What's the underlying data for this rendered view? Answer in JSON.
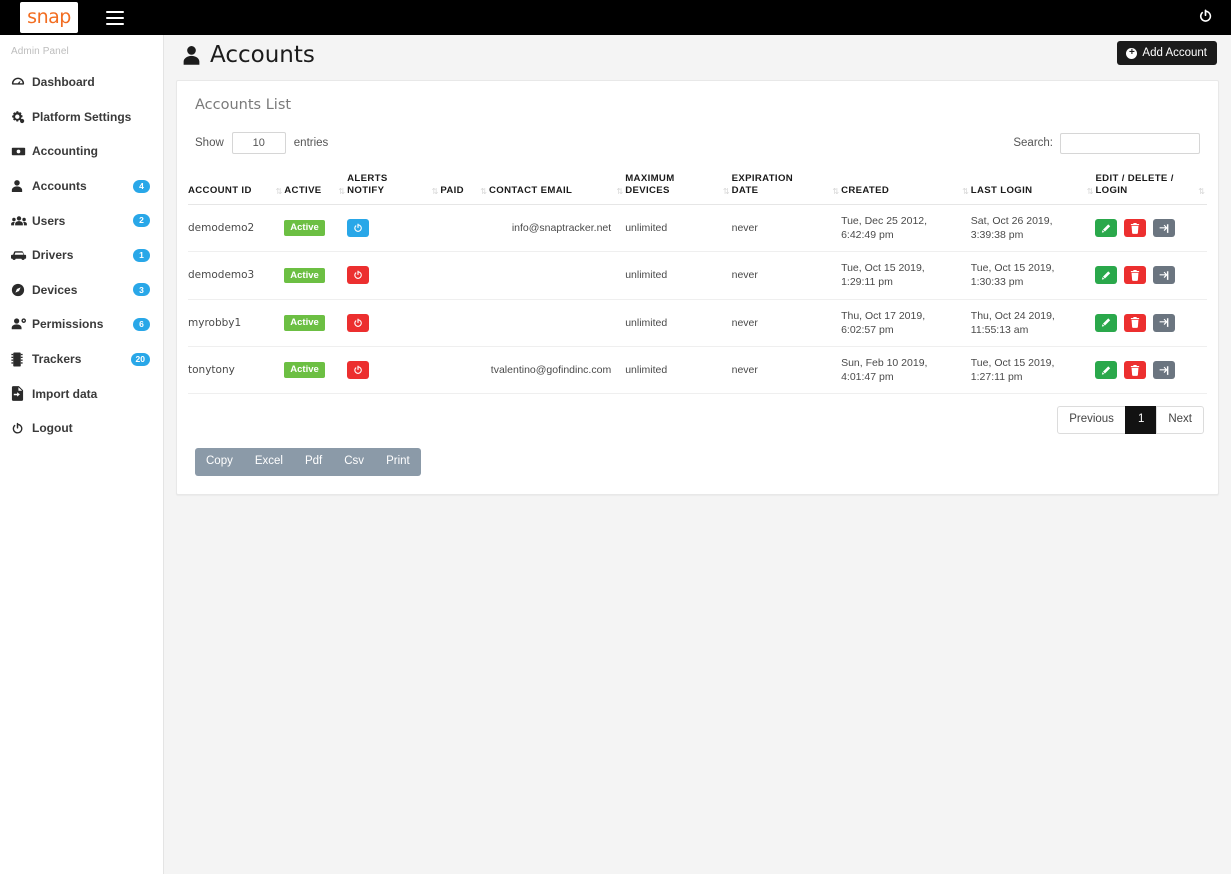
{
  "topbar": {
    "logo_text": "snap",
    "menu_icon": "hamburger-icon",
    "power_icon": "⏻"
  },
  "sidebar": {
    "title": "Admin Panel",
    "items": [
      {
        "label": "Dashboard",
        "icon": "dashboard-icon",
        "badge": ""
      },
      {
        "label": "Platform Settings",
        "icon": "gears-icon",
        "badge": ""
      },
      {
        "label": "Accounting",
        "icon": "money-icon",
        "badge": ""
      },
      {
        "label": "Accounts",
        "icon": "user-icon",
        "badge": "4"
      },
      {
        "label": "Users",
        "icon": "users-icon",
        "badge": "2"
      },
      {
        "label": "Drivers",
        "icon": "car-icon",
        "badge": "1"
      },
      {
        "label": "Devices",
        "icon": "compass-icon",
        "badge": "3"
      },
      {
        "label": "Permissions",
        "icon": "user-gear-icon",
        "badge": "6"
      },
      {
        "label": "Trackers",
        "icon": "tracker-icon",
        "badge": "20"
      },
      {
        "label": "Import data",
        "icon": "import-icon",
        "badge": ""
      },
      {
        "label": "Logout",
        "icon": "power-icon",
        "badge": ""
      }
    ],
    "badge_color": "#29a7e8"
  },
  "header": {
    "title": "Accounts",
    "title_icon": "person-icon",
    "add_button": "Add Account",
    "add_button_icon": "plus-circle-icon"
  },
  "panel": {
    "title": "Accounts List",
    "length": {
      "prefix": "Show",
      "value": "10",
      "suffix": "entries"
    },
    "search": {
      "label": "Search:",
      "value": "",
      "placeholder": ""
    }
  },
  "table": {
    "columns": [
      "ACCOUNT ID",
      "ACTIVE",
      "ALERTS\nNOTIFY",
      "PAID",
      "CONTACT EMAIL",
      "MAXIMUM\nDEVICES",
      "EXPIRATION\nDATE",
      "CREATED",
      "LAST LOGIN",
      "EDIT / DELETE /\nLOGIN"
    ],
    "sort_icon": "sort-icon",
    "rows": [
      {
        "account_id": "demodemo2",
        "active": "Active",
        "alerts_notify": "on",
        "paid": "",
        "contact_email": "info@snaptracker.net",
        "maximum_devices": "unlimited",
        "expiration_date": "never",
        "created": "Tue, Dec 25 2012, 6:42:49 pm",
        "last_login": "Sat, Oct 26 2019, 3:39:38 pm"
      },
      {
        "account_id": "demodemo3",
        "active": "Active",
        "alerts_notify": "off",
        "paid": "",
        "contact_email": "",
        "maximum_devices": "unlimited",
        "expiration_date": "never",
        "created": "Tue, Oct 15 2019, 1:29:11 pm",
        "last_login": "Tue, Oct 15 2019, 1:30:33 pm"
      },
      {
        "account_id": "myrobby1",
        "active": "Active",
        "alerts_notify": "off",
        "paid": "",
        "contact_email": "",
        "maximum_devices": "unlimited",
        "expiration_date": "never",
        "created": "Thu, Oct 17 2019, 6:02:57 pm",
        "last_login": "Thu, Oct 24 2019, 11:55:13 am"
      },
      {
        "account_id": "tonytony",
        "active": "Active",
        "alerts_notify": "off",
        "paid": "",
        "contact_email": "tvalentino@gofindinc.com",
        "maximum_devices": "unlimited",
        "expiration_date": "never",
        "created": "Sun, Feb 10 2019, 4:01:47 pm",
        "last_login": "Tue, Oct 15 2019, 1:27:11 pm"
      }
    ],
    "row_actions": {
      "edit": "edit-icon",
      "delete": "trash-icon",
      "login": "sign-in-icon"
    }
  },
  "pagination": {
    "previous": "Previous",
    "pages": [
      "1"
    ],
    "current": "1",
    "next": "Next"
  },
  "exporters": [
    "Copy",
    "Excel",
    "Pdf",
    "Csv",
    "Print"
  ],
  "colors": {
    "topbar": "#000000",
    "brand_orange": "#f26d21",
    "active_green": "#6cbf43",
    "alert_blue": "#29a7e8",
    "alert_red": "#ec2f2f",
    "edit_green": "#2aa84b",
    "login_gray": "#6b7580",
    "export_bar": "#8b9aa8",
    "page_bg": "#f4f4f4"
  }
}
